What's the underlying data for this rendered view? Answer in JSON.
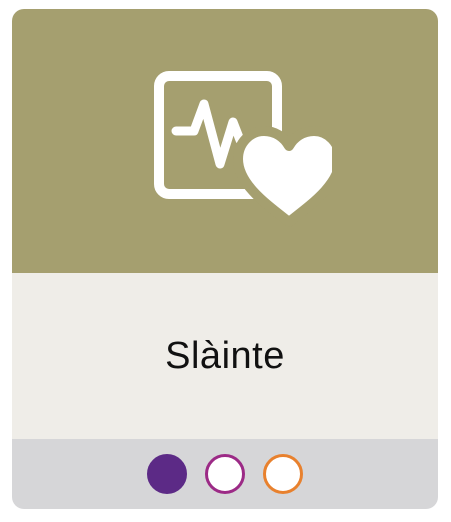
{
  "card": {
    "title": "Slàinte",
    "icon": "health-monitor-heart-icon",
    "colors": {
      "hero_bg": "#a59f6f",
      "label_bg": "#efede8",
      "dots_bg": "#d6d6d8",
      "icon_stroke": "#ffffff"
    }
  },
  "indicators": [
    {
      "name": "indicator-dot-1",
      "filled": true,
      "color": "#5c2a86"
    },
    {
      "name": "indicator-dot-2",
      "filled": false,
      "color": "#9c2a86"
    },
    {
      "name": "indicator-dot-3",
      "filled": false,
      "color": "#e8812e"
    }
  ]
}
